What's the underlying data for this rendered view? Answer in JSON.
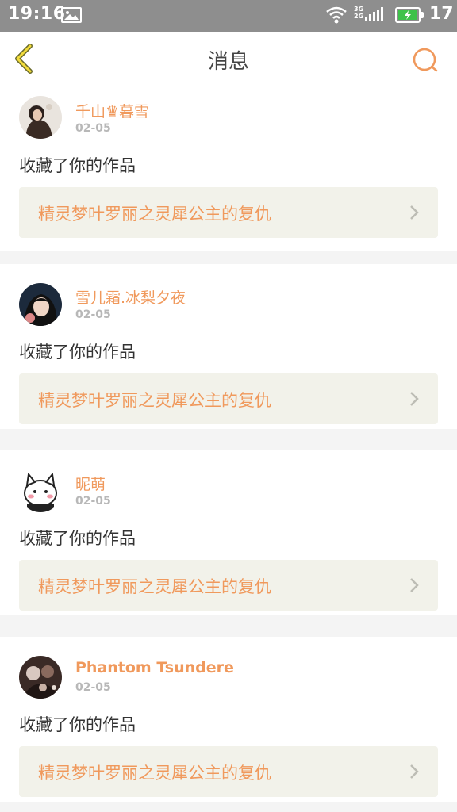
{
  "status_bar": {
    "time": "19:16",
    "net_type_top": "3G",
    "net_type_bottom": "2G",
    "battery_level": "17",
    "battery_color": "#3ec24a",
    "icons": [
      "gallery-icon",
      "wifi-icon",
      "signal-icon",
      "battery-icon"
    ]
  },
  "header": {
    "title": "消息",
    "back_icon": "chevron-left-icon",
    "search_icon": "search-icon",
    "accent_color": "#f0995c"
  },
  "messages": [
    {
      "user": "千山♛暮雪",
      "date": "02-05",
      "action": "收藏了你的作品",
      "work_title": "精灵梦叶罗丽之灵犀公主的复仇"
    },
    {
      "user": "雪儿霜.冰梨夕夜",
      "date": "02-05",
      "action": "收藏了你的作品",
      "work_title": "精灵梦叶罗丽之灵犀公主的复仇"
    },
    {
      "user": "昵萌",
      "date": "02-05",
      "action": "收藏了你的作品",
      "work_title": "精灵梦叶罗丽之灵犀公主的复仇"
    },
    {
      "user": "Phantom Tsundere",
      "date": "02-05",
      "action": "收藏了你的作品",
      "work_title": "精灵梦叶罗丽之灵犀公主的复仇"
    }
  ]
}
